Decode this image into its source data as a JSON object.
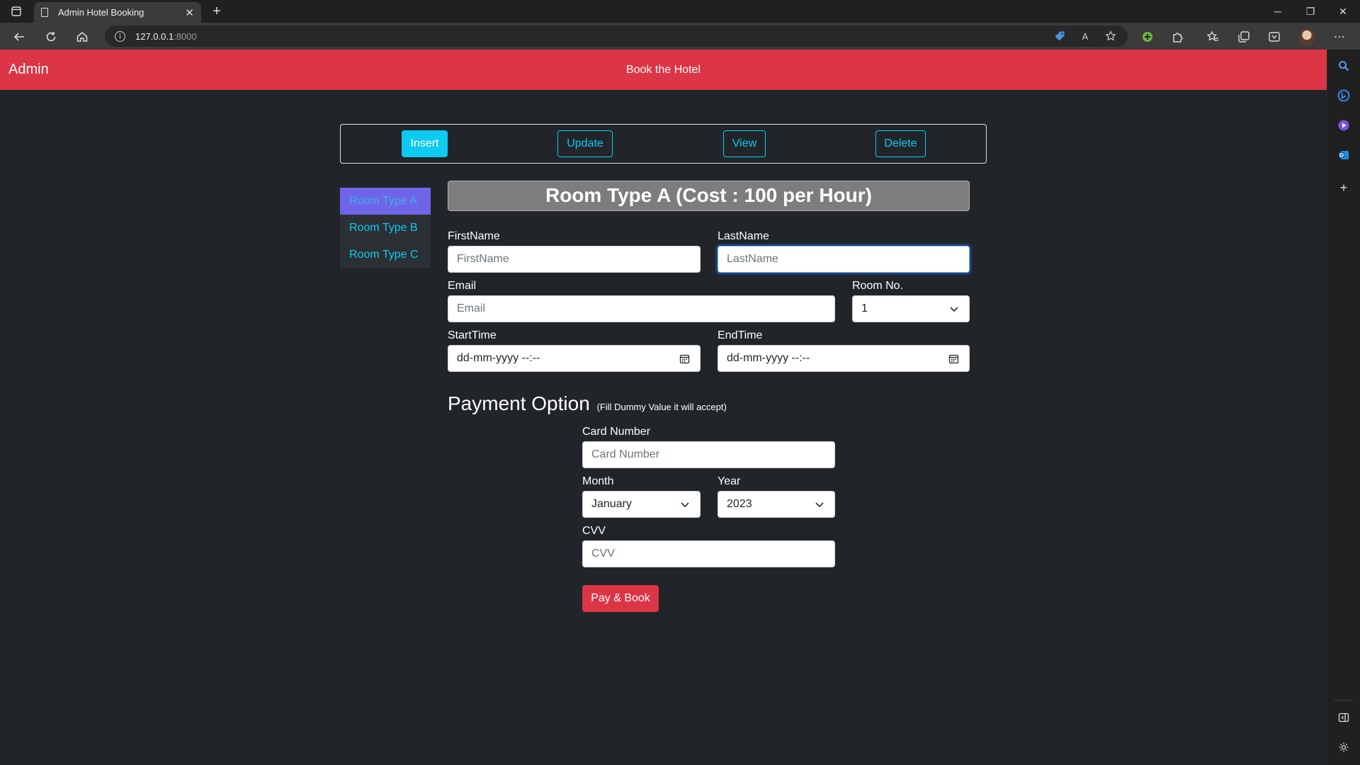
{
  "browser": {
    "tab_title": "Admin Hotel Booking",
    "tab_close": "✕",
    "new_tab": "+",
    "url_host": "127.0.0.1",
    "url_port": ":8000",
    "info_glyph": "i",
    "read_aloud": "A",
    "more": "⋯",
    "minimize": "─",
    "restore": "❐",
    "close": "✕"
  },
  "navbar": {
    "brand": "Admin",
    "title": "Book the Hotel"
  },
  "actions": {
    "insert": "Insert",
    "update": "Update",
    "view": "View",
    "delete": "Delete"
  },
  "rooms": {
    "items": [
      {
        "label": "Room Type A",
        "active": true
      },
      {
        "label": "Room Type B",
        "active": false
      },
      {
        "label": "Room Type C",
        "active": false
      }
    ]
  },
  "form": {
    "title": "Room Type A (Cost : 100 per Hour)",
    "first_name": {
      "label": "FirstName",
      "placeholder": "FirstName",
      "value": ""
    },
    "last_name": {
      "label": "LastName",
      "placeholder": "LastName",
      "value": ""
    },
    "email": {
      "label": "Email",
      "placeholder": "Email",
      "value": ""
    },
    "room_no": {
      "label": "Room No.",
      "value": "1"
    },
    "start_time": {
      "label": "StartTime",
      "value": "dd-mm-yyyy --:--"
    },
    "end_time": {
      "label": "EndTime",
      "value": "dd-mm-yyyy --:--"
    }
  },
  "payment": {
    "heading": "Payment Option",
    "note": "(Fill Dummy Value it will accept)",
    "card_number": {
      "label": "Card Number",
      "placeholder": "Card Number",
      "value": ""
    },
    "month": {
      "label": "Month",
      "value": "January"
    },
    "year": {
      "label": "Year",
      "value": "2023"
    },
    "cvv": {
      "label": "CVV",
      "placeholder": "CVV",
      "value": ""
    },
    "submit": "Pay & Book"
  },
  "colors": {
    "navbar": "#dc3545",
    "info": "#0dcaf0",
    "active_room": "#6f64e8",
    "page_bg": "#212529"
  }
}
